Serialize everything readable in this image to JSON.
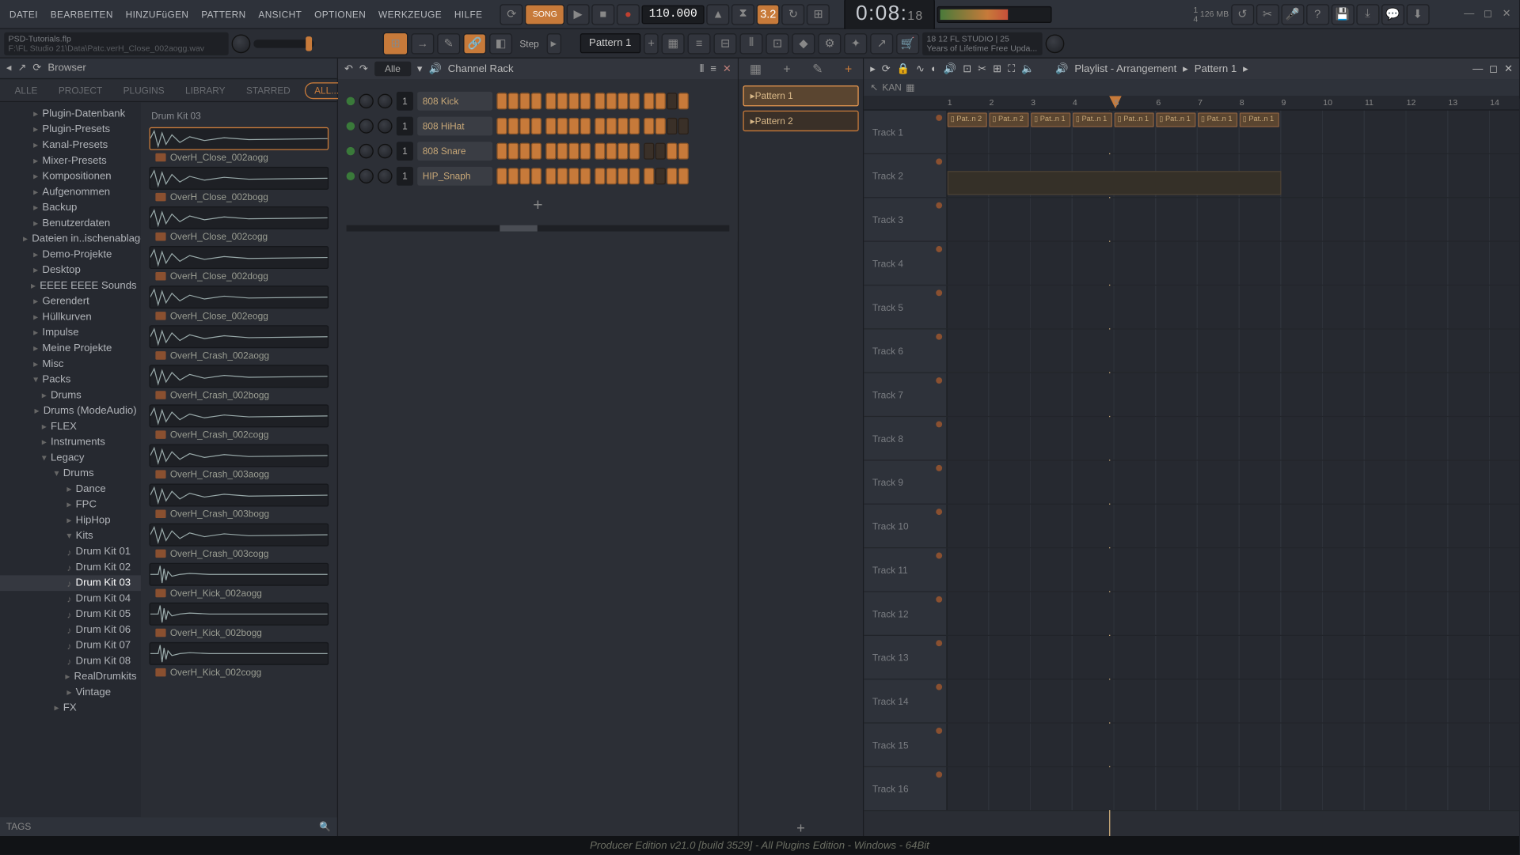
{
  "menu": {
    "items": [
      "DATEI",
      "BEARBEITEN",
      "HINZUFüGEN",
      "PATTERN",
      "ANSICHT",
      "OPTIONEN",
      "WERKZEUGE",
      "HILFE"
    ]
  },
  "transport": {
    "song_btn": "SONG",
    "tempo": "110.000",
    "time_main": "0:08:",
    "time_ms": "18",
    "cpu": "1",
    "mem": "126 MB",
    "date": "4"
  },
  "toolbar2": {
    "hint_title": "PSD-Tutorials.flp",
    "hint_path": "F:\\FL Studio 21\\Data\\Patc.verH_Close_002aogg.wav",
    "step": "Step",
    "pattern": "Pattern 1",
    "info1": "18 12 FL STUDIO | 25",
    "info2": "Years of Lifetime Free Upda..."
  },
  "browser": {
    "title": "Browser",
    "tabs": [
      "ALLE",
      "PROJECT",
      "PLUGINS",
      "LIBRARY",
      "STARRED",
      "ALL..."
    ],
    "tree": [
      {
        "label": "Plugin-Datenbank",
        "lvl": 0
      },
      {
        "label": "Plugin-Presets",
        "lvl": 0
      },
      {
        "label": "Kanal-Presets",
        "lvl": 0
      },
      {
        "label": "Mixer-Presets",
        "lvl": 0
      },
      {
        "label": "Kompositionen",
        "lvl": 0
      },
      {
        "label": "Aufgenommen",
        "lvl": 0
      },
      {
        "label": "Backup",
        "lvl": 0
      },
      {
        "label": "Benutzerdaten",
        "lvl": 0
      },
      {
        "label": "Dateien in..ischenablage",
        "lvl": 0
      },
      {
        "label": "Demo-Projekte",
        "lvl": 0
      },
      {
        "label": "Desktop",
        "lvl": 0
      },
      {
        "label": "EEEE EEEE Sounds",
        "lvl": 0
      },
      {
        "label": "Gerendert",
        "lvl": 0
      },
      {
        "label": "Hüllkurven",
        "lvl": 0
      },
      {
        "label": "Impulse",
        "lvl": 0
      },
      {
        "label": "Meine Projekte",
        "lvl": 0
      },
      {
        "label": "Misc",
        "lvl": 0
      },
      {
        "label": "Packs",
        "lvl": 0,
        "open": true
      },
      {
        "label": "Drums",
        "lvl": 1
      },
      {
        "label": "Drums (ModeAudio)",
        "lvl": 1
      },
      {
        "label": "FLEX",
        "lvl": 1
      },
      {
        "label": "Instruments",
        "lvl": 1
      },
      {
        "label": "Legacy",
        "lvl": 1,
        "open": true
      },
      {
        "label": "Drums",
        "lvl": 2,
        "open": true
      },
      {
        "label": "Dance",
        "lvl": 3
      },
      {
        "label": "FPC",
        "lvl": 3
      },
      {
        "label": "HipHop",
        "lvl": 3
      },
      {
        "label": "Kits",
        "lvl": 3,
        "open": true
      },
      {
        "label": "Drum Kit 01",
        "lvl": 3,
        "kit": true
      },
      {
        "label": "Drum Kit 02",
        "lvl": 3,
        "kit": true
      },
      {
        "label": "Drum Kit 03",
        "lvl": 3,
        "kit": true,
        "sel": true
      },
      {
        "label": "Drum Kit 04",
        "lvl": 3,
        "kit": true
      },
      {
        "label": "Drum Kit 05",
        "lvl": 3,
        "kit": true
      },
      {
        "label": "Drum Kit 06",
        "lvl": 3,
        "kit": true
      },
      {
        "label": "Drum Kit 07",
        "lvl": 3,
        "kit": true
      },
      {
        "label": "Drum Kit 08",
        "lvl": 3,
        "kit": true
      },
      {
        "label": "RealDrumkits",
        "lvl": 3
      },
      {
        "label": "Vintage",
        "lvl": 3
      },
      {
        "label": "FX",
        "lvl": 2
      }
    ],
    "list_title": "Drum Kit 03",
    "samples": [
      {
        "name": "OverH_Close_002aogg",
        "sel": true
      },
      {
        "name": "OverH_Close_002bogg"
      },
      {
        "name": "OverH_Close_002cogg"
      },
      {
        "name": "OverH_Close_002dogg"
      },
      {
        "name": "OverH_Close_002eogg"
      },
      {
        "name": "OverH_Crash_002aogg"
      },
      {
        "name": "OverH_Crash_002bogg"
      },
      {
        "name": "OverH_Crash_002cogg"
      },
      {
        "name": "OverH_Crash_003aogg"
      },
      {
        "name": "OverH_Crash_003bogg"
      },
      {
        "name": "OverH_Crash_003cogg"
      },
      {
        "name": "OverH_Kick_002aogg",
        "kick": true
      },
      {
        "name": "OverH_Kick_002bogg",
        "kick": true
      },
      {
        "name": "OverH_Kick_002cogg",
        "kick": true
      }
    ],
    "tags": "TAGS"
  },
  "chrack": {
    "title": "Channel Rack",
    "filter": "Alle",
    "channels": [
      {
        "name": "808 Kick",
        "num": "1"
      },
      {
        "name": "808 HiHat",
        "num": "1"
      },
      {
        "name": "808 Snare",
        "num": "1"
      },
      {
        "name": "HIP_Snaph",
        "num": "1"
      }
    ]
  },
  "patpick": {
    "items": [
      "Pattern 1",
      "Pattern 2"
    ]
  },
  "playlist": {
    "title": "Playlist - Arrangement",
    "crumb": "Pattern 1",
    "bars": [
      1,
      2,
      3,
      4,
      5,
      6,
      7,
      8,
      9,
      10,
      11,
      12,
      13,
      14
    ],
    "tracks": [
      "Track 1",
      "Track 2",
      "Track 3",
      "Track 4",
      "Track 5",
      "Track 6",
      "Track 7",
      "Track 8",
      "Track 9",
      "Track 10",
      "Track 11",
      "Track 12",
      "Track 13",
      "Track 14",
      "Track 15",
      "Track 16"
    ],
    "clips": [
      "Pat..n 2",
      "Pat..n 2",
      "Pat..n 1",
      "Pat..n 1",
      "Pat..n 1",
      "Pat..n 1",
      "Pat..n 1",
      "Pat..n 1"
    ]
  },
  "status": "Producer Edition v21.0 [build 3529] - All Plugins Edition - Windows - 64Bit"
}
